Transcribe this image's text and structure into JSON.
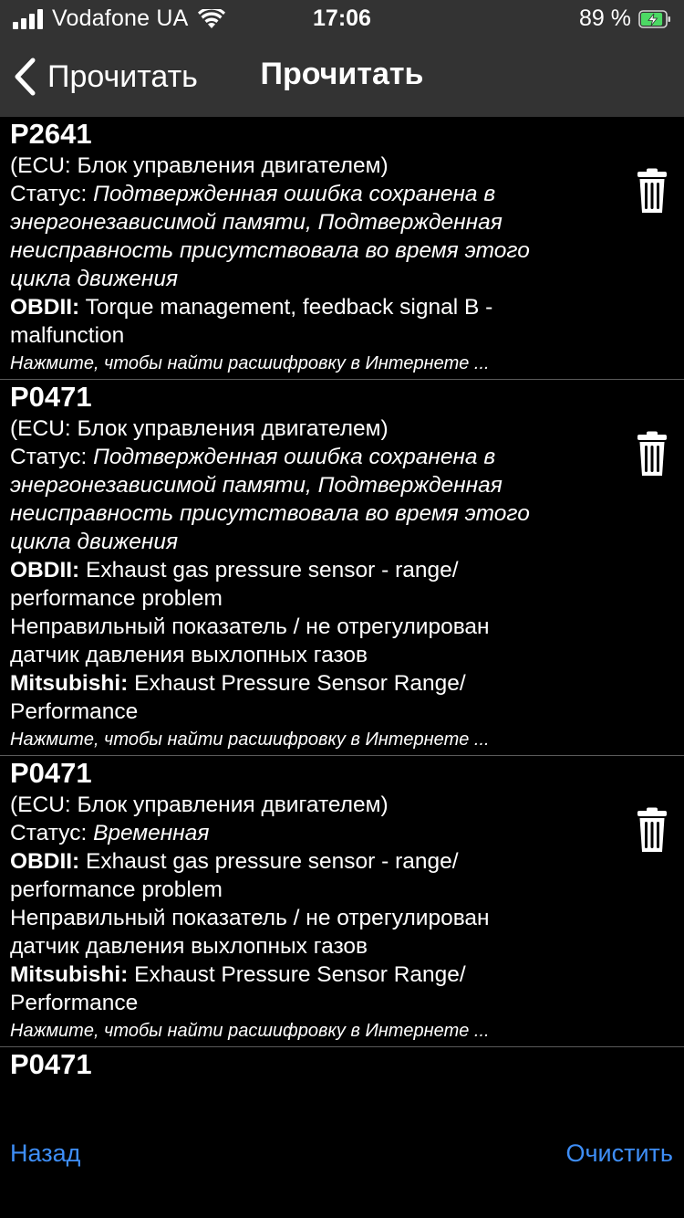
{
  "status_bar": {
    "carrier": "Vodafone UA",
    "time": "17:06",
    "battery_percent": "89 %",
    "battery_level": 0.89
  },
  "nav": {
    "back_label": "Прочитать",
    "title": "Прочитать"
  },
  "dtcs": [
    {
      "code": "P2641",
      "ecu": "(ECU: Блок управления двигателем)",
      "status_prefix": "Статус: ",
      "status_lines": [
        "Подтвержденная ошибка сохранена в",
        "энергонезависимой памяти, Подтвержденная",
        "неисправность присутствовала во время этого",
        "цикла движения"
      ],
      "obd_label": "OBDII:",
      "obd_lines": [
        " Torque management, feedback signal B -",
        "malfunction"
      ],
      "translation_lines": [],
      "maker_label": "",
      "maker_lines": [],
      "hint": "Нажмите, чтобы найти расшифровку в Интернете ..."
    },
    {
      "code": "P0471",
      "ecu": "(ECU: Блок управления двигателем)",
      "status_prefix": "Статус: ",
      "status_lines": [
        "Подтвержденная ошибка сохранена в",
        "энергонезависимой памяти, Подтвержденная",
        "неисправность присутствовала во время этого",
        "цикла движения"
      ],
      "obd_label": "OBDII:",
      "obd_lines": [
        " Exhaust gas pressure sensor - range/",
        "performance problem"
      ],
      "translation_lines": [
        "Неправильный показатель / не отрегулирован",
        "датчик давления выхлопных газов"
      ],
      "maker_label": "Mitsubishi:",
      "maker_lines": [
        " Exhaust Pressure Sensor Range/",
        "Performance"
      ],
      "hint": "Нажмите, чтобы найти расшифровку в Интернете ..."
    },
    {
      "code": "P0471",
      "ecu": "(ECU: Блок управления двигателем)",
      "status_prefix": "Статус: ",
      "status_lines": [
        "Временная"
      ],
      "obd_label": "OBDII:",
      "obd_lines": [
        " Exhaust gas pressure sensor - range/",
        "performance problem"
      ],
      "translation_lines": [
        "Неправильный показатель / не отрегулирован",
        "датчик давления выхлопных газов"
      ],
      "maker_label": "Mitsubishi:",
      "maker_lines": [
        " Exhaust Pressure Sensor Range/",
        "Performance"
      ],
      "hint": "Нажмите, чтобы найти расшифровку в Интернете ..."
    },
    {
      "code": "P0471",
      "partial": true
    }
  ],
  "toolbar": {
    "back_label": "Назад",
    "clear_label": "Очистить"
  },
  "colors": {
    "bar_background": "#333333",
    "link_blue": "#3e8ef7",
    "battery_green": "#4cd964"
  },
  "icons": {
    "delete": "trash-icon",
    "back": "chevron-left-icon"
  }
}
